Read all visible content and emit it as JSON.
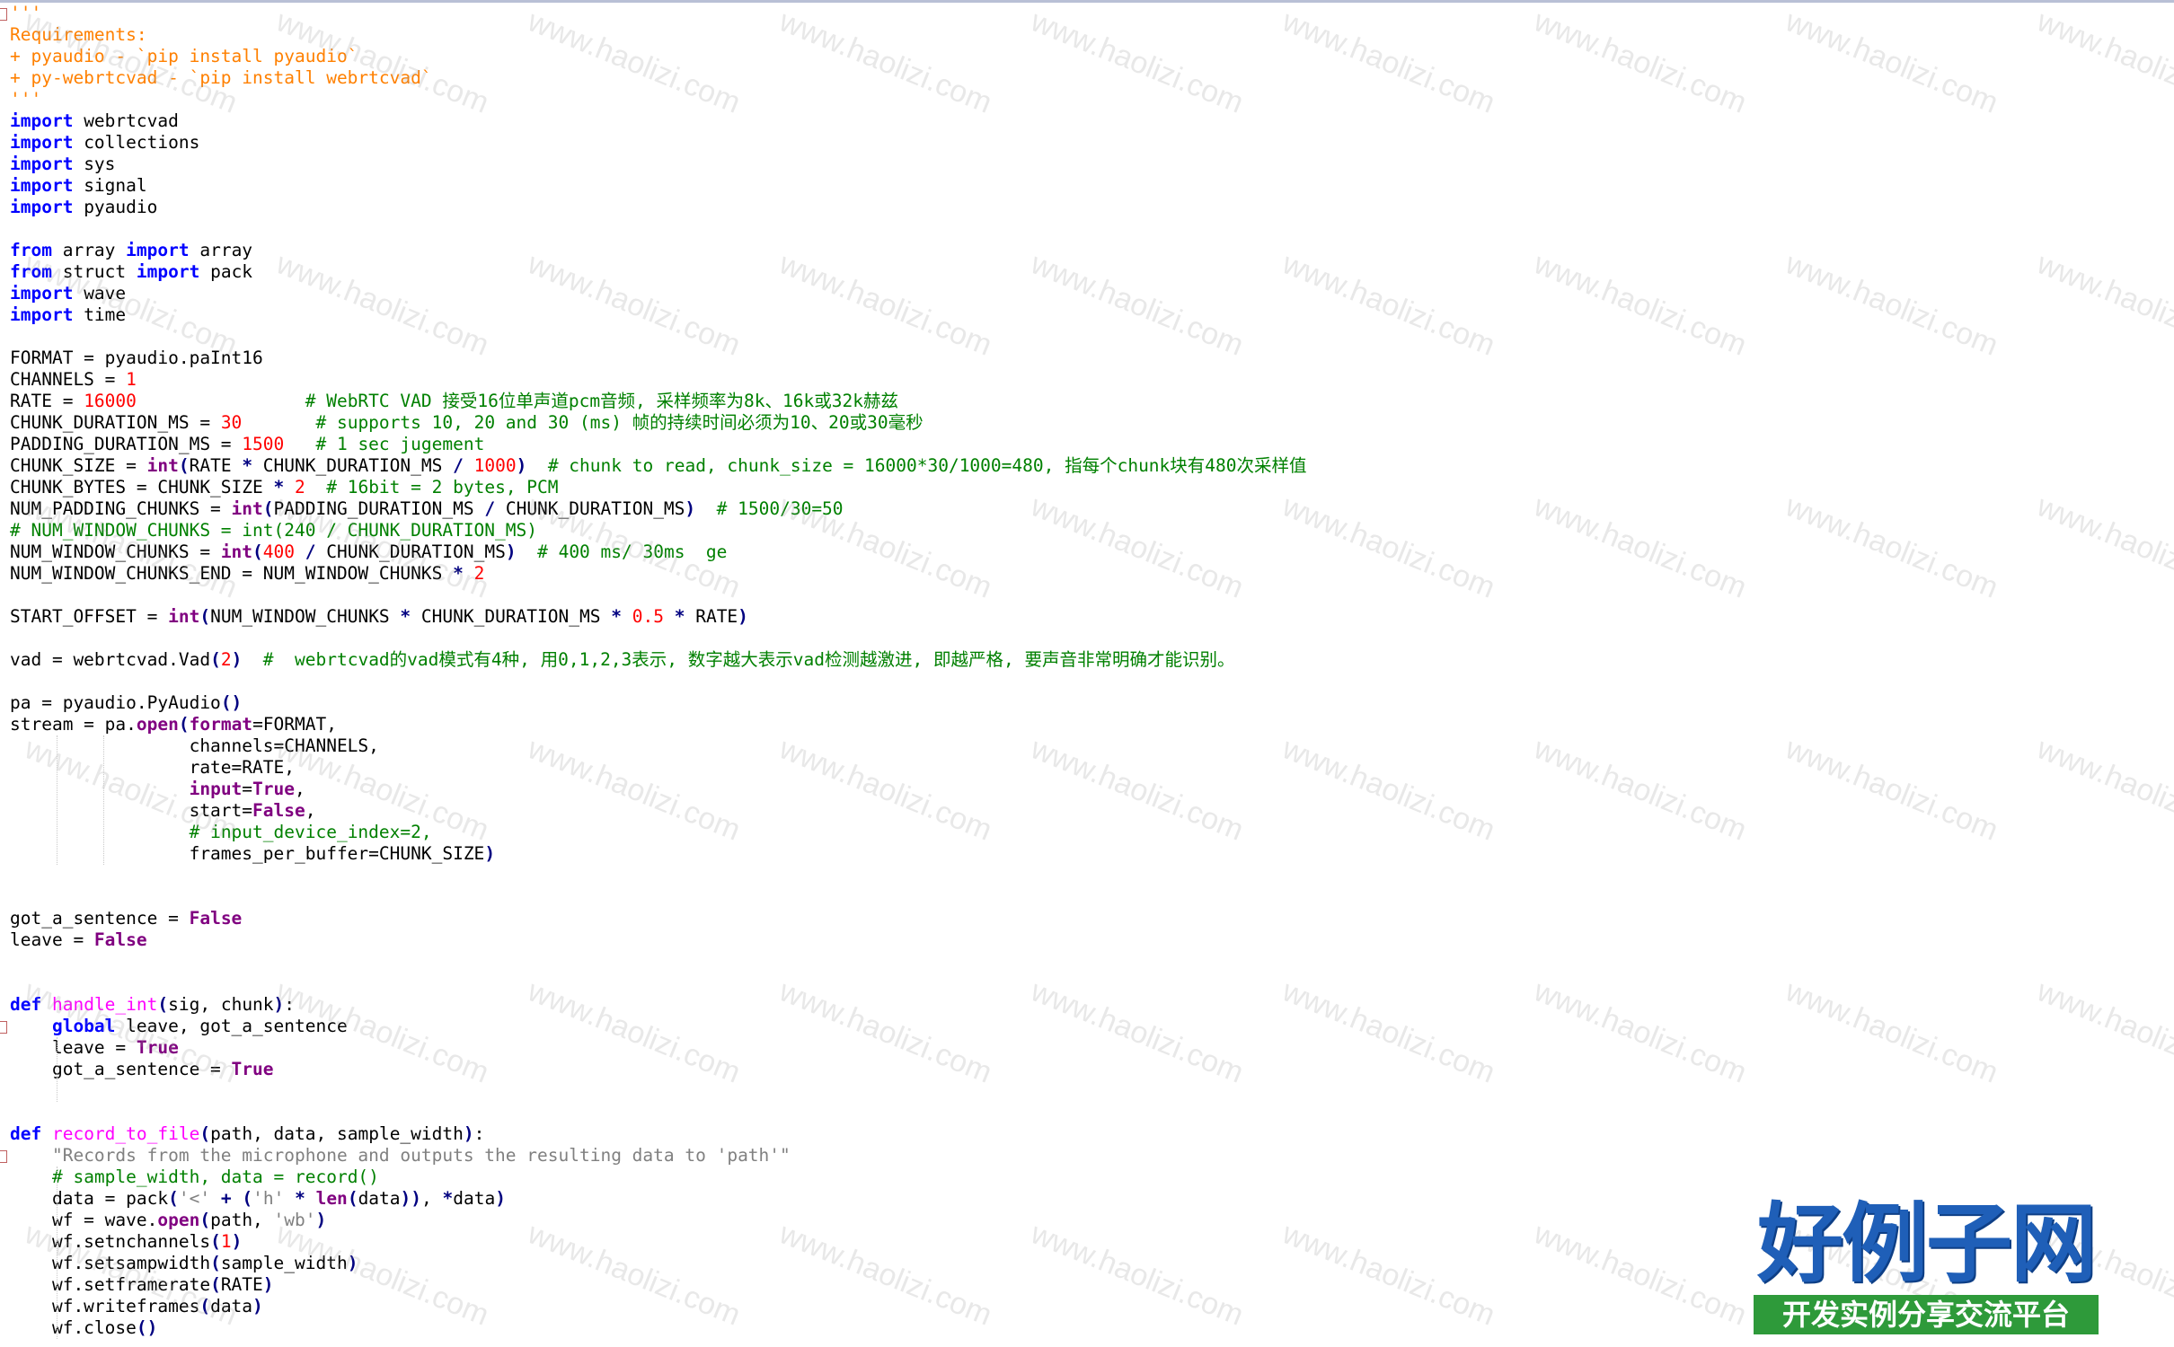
{
  "editor": {
    "lines": [
      [
        [
          "doc",
          "'''"
        ]
      ],
      [
        [
          "doc",
          "Requirements:"
        ]
      ],
      [
        [
          "doc",
          "+ pyaudio - `pip install pyaudio`"
        ]
      ],
      [
        [
          "doc",
          "+ py-webrtcvad - `pip install webrtcvad`"
        ]
      ],
      [
        [
          "doc",
          "'''"
        ]
      ],
      [
        [
          "kw",
          "import"
        ],
        [
          "",
          " webrtcvad"
        ]
      ],
      [
        [
          "kw",
          "import"
        ],
        [
          "",
          " collections"
        ]
      ],
      [
        [
          "kw",
          "import"
        ],
        [
          "",
          " sys"
        ]
      ],
      [
        [
          "kw",
          "import"
        ],
        [
          "",
          " signal"
        ]
      ],
      [
        [
          "kw",
          "import"
        ],
        [
          "",
          " pyaudio"
        ]
      ],
      [],
      [
        [
          "kw",
          "from"
        ],
        [
          "",
          " array "
        ],
        [
          "kw",
          "import"
        ],
        [
          "",
          " array"
        ]
      ],
      [
        [
          "kw",
          "from"
        ],
        [
          "",
          " struct "
        ],
        [
          "kw",
          "import"
        ],
        [
          "",
          " pack"
        ]
      ],
      [
        [
          "kw",
          "import"
        ],
        [
          "",
          " wave"
        ]
      ],
      [
        [
          "kw",
          "import"
        ],
        [
          "",
          " time"
        ]
      ],
      [],
      [
        [
          "",
          "FORMAT = pyaudio.paInt16"
        ]
      ],
      [
        [
          "",
          "CHANNELS = "
        ],
        [
          "num",
          "1"
        ]
      ],
      [
        [
          "",
          "RATE = "
        ],
        [
          "num",
          "16000"
        ],
        [
          "",
          "                "
        ],
        [
          "cm",
          "# WebRTC VAD 接受16位单声道pcm音频, 采样频率为8k、16k或32k赫兹"
        ]
      ],
      [
        [
          "",
          "CHUNK_DURATION_MS = "
        ],
        [
          "num",
          "30"
        ],
        [
          "",
          "       "
        ],
        [
          "cm",
          "# supports 10, 20 and 30 (ms) 帧的持续时间必须为10、20或30毫秒"
        ]
      ],
      [
        [
          "",
          "PADDING_DURATION_MS = "
        ],
        [
          "num",
          "1500"
        ],
        [
          "",
          "   "
        ],
        [
          "cm",
          "# 1 sec jugement"
        ]
      ],
      [
        [
          "",
          "CHUNK_SIZE = "
        ],
        [
          "kw2",
          "int"
        ],
        [
          "op",
          "("
        ],
        [
          "",
          "RATE "
        ],
        [
          "op",
          "*"
        ],
        [
          "",
          " CHUNK_DURATION_MS "
        ],
        [
          "op",
          "/"
        ],
        [
          "",
          " "
        ],
        [
          "num",
          "1000"
        ],
        [
          "op",
          ")"
        ],
        [
          "",
          "  "
        ],
        [
          "cm",
          "# chunk to read, chunk_size = 16000*30/1000=480, 指每个chunk块有480次采样值"
        ]
      ],
      [
        [
          "",
          "CHUNK_BYTES = CHUNK_SIZE "
        ],
        [
          "op",
          "*"
        ],
        [
          "",
          " "
        ],
        [
          "num",
          "2"
        ],
        [
          "",
          "  "
        ],
        [
          "cm",
          "# 16bit = 2 bytes, PCM"
        ]
      ],
      [
        [
          "",
          "NUM_PADDING_CHUNKS = "
        ],
        [
          "kw2",
          "int"
        ],
        [
          "op",
          "("
        ],
        [
          "",
          "PADDING_DURATION_MS "
        ],
        [
          "op",
          "/"
        ],
        [
          "",
          " CHUNK_DURATION_MS"
        ],
        [
          "op",
          ")"
        ],
        [
          "",
          "  "
        ],
        [
          "cm",
          "# 1500/30=50"
        ]
      ],
      [
        [
          "cm",
          "# NUM_WINDOW_CHUNKS = int(240 / CHUNK_DURATION_MS)"
        ]
      ],
      [
        [
          "",
          "NUM_WINDOW_CHUNKS = "
        ],
        [
          "kw2",
          "int"
        ],
        [
          "op",
          "("
        ],
        [
          "num",
          "400"
        ],
        [
          "",
          " "
        ],
        [
          "op",
          "/"
        ],
        [
          "",
          " CHUNK_DURATION_MS"
        ],
        [
          "op",
          ")"
        ],
        [
          "",
          "  "
        ],
        [
          "cm",
          "# 400 ms/ 30ms  ge"
        ]
      ],
      [
        [
          "",
          "NUM_WINDOW_CHUNKS_END = NUM_WINDOW_CHUNKS "
        ],
        [
          "op",
          "*"
        ],
        [
          "",
          " "
        ],
        [
          "num",
          "2"
        ]
      ],
      [],
      [
        [
          "",
          "START_OFFSET = "
        ],
        [
          "kw2",
          "int"
        ],
        [
          "op",
          "("
        ],
        [
          "",
          "NUM_WINDOW_CHUNKS "
        ],
        [
          "op",
          "*"
        ],
        [
          "",
          " CHUNK_DURATION_MS "
        ],
        [
          "op",
          "*"
        ],
        [
          "",
          " "
        ],
        [
          "num",
          "0.5"
        ],
        [
          "",
          " "
        ],
        [
          "op",
          "*"
        ],
        [
          "",
          " RATE"
        ],
        [
          "op",
          ")"
        ]
      ],
      [],
      [
        [
          "",
          "vad = webrtcvad.Vad"
        ],
        [
          "op",
          "("
        ],
        [
          "num",
          "2"
        ],
        [
          "op",
          ")"
        ],
        [
          "",
          "  "
        ],
        [
          "cm",
          "#  webrtcvad的vad模式有4种, 用0,1,2,3表示, 数字越大表示vad检测越激进, 即越严格, 要声音非常明确才能识别。"
        ]
      ],
      [],
      [
        [
          "",
          "pa = pyaudio.PyAudio"
        ],
        [
          "op",
          "()"
        ]
      ],
      [
        [
          "",
          "stream = pa."
        ],
        [
          "kw2",
          "open"
        ],
        [
          "op",
          "("
        ],
        [
          "kw2",
          "format"
        ],
        [
          "",
          "=FORMAT,"
        ]
      ],
      [
        [
          "",
          "                 channels=CHANNELS,"
        ]
      ],
      [
        [
          "",
          "                 rate=RATE,"
        ]
      ],
      [
        [
          "",
          "                 "
        ],
        [
          "kw2",
          "input"
        ],
        [
          "",
          "="
        ],
        [
          "kw2",
          "True"
        ],
        [
          "",
          ","
        ]
      ],
      [
        [
          "",
          "                 start="
        ],
        [
          "kw2",
          "False"
        ],
        [
          "",
          ","
        ]
      ],
      [
        [
          "",
          "                 "
        ],
        [
          "cm",
          "# input_device_index=2,"
        ]
      ],
      [
        [
          "",
          "                 frames_per_buffer=CHUNK_SIZE"
        ],
        [
          "op",
          ")"
        ]
      ],
      [],
      [],
      [
        [
          "",
          "got_a_sentence = "
        ],
        [
          "kw2",
          "False"
        ]
      ],
      [
        [
          "",
          "leave = "
        ],
        [
          "kw2",
          "False"
        ]
      ],
      [],
      [],
      [
        [
          "kw",
          "def"
        ],
        [
          "",
          " "
        ],
        [
          "fn",
          "handle_int"
        ],
        [
          "op",
          "("
        ],
        [
          "",
          "sig, chunk"
        ],
        [
          "op",
          ")"
        ],
        [
          "",
          ":"
        ]
      ],
      [
        [
          "",
          "    "
        ],
        [
          "kw",
          "global"
        ],
        [
          "",
          " leave, got_a_sentence"
        ]
      ],
      [
        [
          "",
          "    leave = "
        ],
        [
          "kw2",
          "True"
        ]
      ],
      [
        [
          "",
          "    got_a_sentence = "
        ],
        [
          "kw2",
          "True"
        ]
      ],
      [],
      [],
      [
        [
          "kw",
          "def"
        ],
        [
          "",
          " "
        ],
        [
          "fn",
          "record_to_file"
        ],
        [
          "op",
          "("
        ],
        [
          "",
          "path, data, sample_width"
        ],
        [
          "op",
          ")"
        ],
        [
          "",
          ":"
        ]
      ],
      [
        [
          "",
          "    "
        ],
        [
          "str",
          "\"Records from the microphone and outputs the resulting data to 'path'\""
        ]
      ],
      [
        [
          "",
          "    "
        ],
        [
          "cm",
          "# sample_width, data = record()"
        ]
      ],
      [
        [
          "",
          "    data = pack"
        ],
        [
          "op",
          "("
        ],
        [
          "str",
          "'<'"
        ],
        [
          "",
          " "
        ],
        [
          "op",
          "+"
        ],
        [
          "",
          " "
        ],
        [
          "op",
          "("
        ],
        [
          "str",
          "'h'"
        ],
        [
          "",
          " "
        ],
        [
          "op",
          "*"
        ],
        [
          "",
          " "
        ],
        [
          "kw2",
          "len"
        ],
        [
          "op",
          "("
        ],
        [
          "",
          "data"
        ],
        [
          "op",
          "))"
        ],
        [
          "",
          ", "
        ],
        [
          "op",
          "*"
        ],
        [
          "",
          "data"
        ],
        [
          "op",
          ")"
        ]
      ],
      [
        [
          "",
          "    wf = wave."
        ],
        [
          "kw2",
          "open"
        ],
        [
          "op",
          "("
        ],
        [
          "",
          "path, "
        ],
        [
          "str",
          "'wb'"
        ],
        [
          "op",
          ")"
        ]
      ],
      [
        [
          "",
          "    wf.setnchannels"
        ],
        [
          "op",
          "("
        ],
        [
          "num",
          "1"
        ],
        [
          "op",
          ")"
        ]
      ],
      [
        [
          "",
          "    wf.setsampwidth"
        ],
        [
          "op",
          "("
        ],
        [
          "",
          "sample_width"
        ],
        [
          "op",
          ")"
        ]
      ],
      [
        [
          "",
          "    wf.setframerate"
        ],
        [
          "op",
          "("
        ],
        [
          "",
          "RATE"
        ],
        [
          "op",
          ")"
        ]
      ],
      [
        [
          "",
          "    wf.writeframes"
        ],
        [
          "op",
          "("
        ],
        [
          "",
          "data"
        ],
        [
          "op",
          ")"
        ]
      ],
      [
        [
          "",
          "    wf.close"
        ],
        [
          "op",
          "()"
        ]
      ]
    ]
  },
  "watermark": {
    "text": "www.haolizi.com"
  },
  "logo": {
    "title": "好例子网",
    "subtitle": "开发实例分享交流平台",
    "title_color": "#1f5fb8",
    "subtitle_bg": "#2e9a3a"
  }
}
